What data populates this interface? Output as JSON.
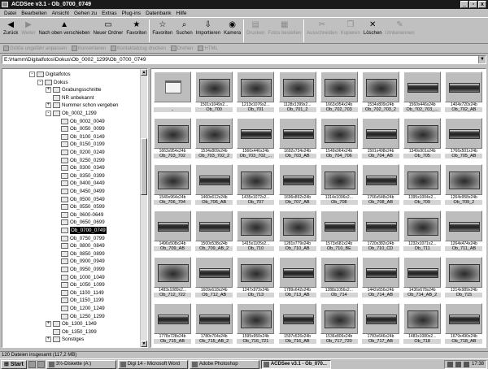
{
  "window": {
    "title": "ACDSee v3.1 - Ob_0700_0749",
    "minimize": "_",
    "restore": "▫",
    "close": "x"
  },
  "menu": [
    "Datei",
    "Bearbeiten",
    "Ansicht",
    "Gehen zu",
    "Extras",
    "Plug-ins",
    "Datenbank",
    "Hilfe"
  ],
  "toolbar": [
    {
      "label": "Zurück",
      "icon": "back-arrow-icon",
      "glyph": "◀",
      "disabled": false
    },
    {
      "label": "Weiter",
      "icon": "forward-arrow-icon",
      "glyph": "▶",
      "disabled": true
    },
    {
      "label": "Nach oben verschieben",
      "icon": "up-folder-icon",
      "glyph": "▲",
      "disabled": false
    },
    {
      "label": "Neuer Ordner",
      "icon": "new-folder-icon",
      "glyph": "▭",
      "disabled": false
    },
    {
      "label": "Favoriten",
      "icon": "favorites-icon",
      "glyph": "★",
      "disabled": false
    },
    {
      "label": "Favoriten",
      "icon": "favorites-menu-icon",
      "glyph": "☆",
      "disabled": false
    },
    {
      "label": "Suchen",
      "icon": "binoculars-icon",
      "glyph": "⌕",
      "disabled": false
    },
    {
      "label": "Importieren",
      "icon": "import-icon",
      "glyph": "⇩",
      "disabled": false
    },
    {
      "label": "Kamera",
      "icon": "camera-icon",
      "glyph": "◉",
      "disabled": false
    },
    {
      "label": "Drucken",
      "icon": "printer-icon",
      "glyph": "▤",
      "disabled": true
    },
    {
      "label": "Fotos bestellen",
      "icon": "order-photos-icon",
      "glyph": "▦",
      "disabled": true
    },
    {
      "label": "Ausschneiden",
      "icon": "scissors-icon",
      "glyph": "✂",
      "disabled": true
    },
    {
      "label": "Kopieren",
      "icon": "copy-icon",
      "glyph": "❐",
      "disabled": true
    },
    {
      "label": "Löschen",
      "icon": "delete-icon",
      "glyph": "✕",
      "disabled": false
    },
    {
      "label": "Umbenennen",
      "icon": "rename-icon",
      "glyph": "✎",
      "disabled": true
    }
  ],
  "toolbar2": [
    "Größe ungefähr anpassen",
    "Konvertieren",
    "Kontaktabzug drucken",
    "Drehen",
    "HTML"
  ],
  "path": "E:\\Hamm\\Digitalfotos\\Dokus\\Ob_0002_1299\\Ob_0700_0749",
  "tree": [
    {
      "label": "Digitalfotos",
      "level": 0,
      "exp": "-",
      "sel": false
    },
    {
      "label": "Dokus",
      "level": 1,
      "exp": "-",
      "sel": false
    },
    {
      "label": "Grabungsschnitte",
      "level": 2,
      "exp": "+",
      "sel": false
    },
    {
      "label": "NR unbekannt",
      "level": 2,
      "exp": "",
      "sel": false
    },
    {
      "label": "Nummer schon vergeben",
      "level": 2,
      "exp": "+",
      "sel": false
    },
    {
      "label": "Ob_0002_1299",
      "level": 2,
      "exp": "-",
      "sel": false
    },
    {
      "label": "Ob_0002_0049",
      "level": 3,
      "exp": "",
      "sel": false
    },
    {
      "label": "Ob_0050_0099",
      "level": 3,
      "exp": "",
      "sel": false
    },
    {
      "label": "Ob_0100_0149",
      "level": 3,
      "exp": "",
      "sel": false
    },
    {
      "label": "Ob_0150_0199",
      "level": 3,
      "exp": "",
      "sel": false
    },
    {
      "label": "Ob_0200_0249",
      "level": 3,
      "exp": "",
      "sel": false
    },
    {
      "label": "Ob_0250_0299",
      "level": 3,
      "exp": "",
      "sel": false
    },
    {
      "label": "Ob_0300_0349",
      "level": 3,
      "exp": "",
      "sel": false
    },
    {
      "label": "Ob_0350_0399",
      "level": 3,
      "exp": "",
      "sel": false
    },
    {
      "label": "Ob_0400_0449",
      "level": 3,
      "exp": "",
      "sel": false
    },
    {
      "label": "Ob_0450_0499",
      "level": 3,
      "exp": "",
      "sel": false
    },
    {
      "label": "Ob_0500_0549",
      "level": 3,
      "exp": "",
      "sel": false
    },
    {
      "label": "Ob_0550_0599",
      "level": 3,
      "exp": "",
      "sel": false
    },
    {
      "label": "Ob_0600-0649",
      "level": 3,
      "exp": "",
      "sel": false
    },
    {
      "label": "Ob_0650_0699",
      "level": 3,
      "exp": "",
      "sel": false
    },
    {
      "label": "Ob_0700_0749",
      "level": 3,
      "exp": "",
      "sel": true
    },
    {
      "label": "Ob_0750_0799",
      "level": 3,
      "exp": "",
      "sel": false
    },
    {
      "label": "Ob_0800_0849",
      "level": 3,
      "exp": "",
      "sel": false
    },
    {
      "label": "Ob_0850_0899",
      "level": 3,
      "exp": "",
      "sel": false
    },
    {
      "label": "Ob_0900_0949",
      "level": 3,
      "exp": "",
      "sel": false
    },
    {
      "label": "Ob_0950_0999",
      "level": 3,
      "exp": "",
      "sel": false
    },
    {
      "label": "Ob_1000_1049",
      "level": 3,
      "exp": "",
      "sel": false
    },
    {
      "label": "Ob_1050_1099",
      "level": 3,
      "exp": "",
      "sel": false
    },
    {
      "label": "Ob_1100_1149",
      "level": 3,
      "exp": "",
      "sel": false
    },
    {
      "label": "Ob_1150_1199",
      "level": 3,
      "exp": "",
      "sel": false
    },
    {
      "label": "Ob_1200_1249",
      "level": 3,
      "exp": "",
      "sel": false
    },
    {
      "label": "Ob_1250_1299",
      "level": 3,
      "exp": "",
      "sel": false
    },
    {
      "label": "Ob_1300_1349",
      "level": 2,
      "exp": "+",
      "sel": false
    },
    {
      "label": "Ob_1350_1399",
      "level": 2,
      "exp": "",
      "sel": false
    },
    {
      "label": "Sonstiges",
      "level": 2,
      "exp": "+",
      "sel": false
    }
  ],
  "thumbnails": [
    {
      "name": "..",
      "size": "",
      "kind": "folder"
    },
    {
      "name": "Ob_700",
      "size": "1501x1049x2...",
      "kind": "photo"
    },
    {
      "name": "Ob_701",
      "size": "1213x1076x2...",
      "kind": "photo"
    },
    {
      "name": "Ob_701_2",
      "size": "1128x1399x2...",
      "kind": "photo"
    },
    {
      "name": "Ob_702_703",
      "size": "1663x954x24b",
      "kind": "photo"
    },
    {
      "name": "Ob_702_703_2",
      "size": "1534x809x24b",
      "kind": "photo"
    },
    {
      "name": "Ob_702_703_...",
      "size": "1560x446x24b",
      "kind": "strip"
    },
    {
      "name": "Ob_702_AB",
      "size": "1404x720x24b",
      "kind": "strip"
    },
    {
      "name": "Ob_703_702",
      "size": "1663x954x24b",
      "kind": "photo"
    },
    {
      "name": "Ob_703_702_2",
      "size": "1534x809x24b",
      "kind": "photo"
    },
    {
      "name": "Ob_703_702_...",
      "size": "1560x446x24b",
      "kind": "strip"
    },
    {
      "name": "Ob_703_AB",
      "size": "1692x734x24b",
      "kind": "strip"
    },
    {
      "name": "Ob_704_706",
      "size": "1549x964x24b",
      "kind": "photo"
    },
    {
      "name": "Ob_704_AB",
      "size": "1501x498x24b",
      "kind": "strip"
    },
    {
      "name": "Ob_705",
      "size": "1349x901x24b",
      "kind": "photo"
    },
    {
      "name": "Ob_705_AB",
      "size": "1766x501x24b",
      "kind": "strip"
    },
    {
      "name": "Ob_706_704",
      "size": "1549x964x24b",
      "kind": "photo"
    },
    {
      "name": "Ob_706_AB",
      "size": "1460x612x24b",
      "kind": "strip"
    },
    {
      "name": "Ob_707",
      "size": "1435x1072x2...",
      "kind": "photo"
    },
    {
      "name": "Ob_707_AB",
      "size": "1696x892x24b",
      "kind": "strip"
    },
    {
      "name": "Ob_708",
      "size": "1314x1096x2...",
      "kind": "photo"
    },
    {
      "name": "Ob_708_AB",
      "size": "1766x548x24b",
      "kind": "strip"
    },
    {
      "name": "Ob_709",
      "size": "1395x1004x2...",
      "kind": "photo"
    },
    {
      "name": "Ob_709_2",
      "size": "1264x958x24b",
      "kind": "photo"
    },
    {
      "name": "Ob_709_AB",
      "size": "1496x508x24b",
      "kind": "strip"
    },
    {
      "name": "Ob_709_AB_2",
      "size": "1500x538x24b",
      "kind": "strip"
    },
    {
      "name": "Ob_710",
      "size": "1415x1105x2...",
      "kind": "photo"
    },
    {
      "name": "Ob_710_AB",
      "size": "1281x779x24b",
      "kind": "photo"
    },
    {
      "name": "Ob_710_BE",
      "size": "1573x681x24b",
      "kind": "strip"
    },
    {
      "name": "Ob_710_CD",
      "size": "1720x382x24b",
      "kind": "strip"
    },
    {
      "name": "Ob_711",
      "size": "1232x1071x2...",
      "kind": "photo"
    },
    {
      "name": "Ob_711_AB",
      "size": "1264x474x24b",
      "kind": "strip"
    },
    {
      "name": "Ob_712_722",
      "size": "1483x1089x2...",
      "kind": "photo"
    },
    {
      "name": "Ob_712_AB",
      "size": "1609x618x24b",
      "kind": "strip"
    },
    {
      "name": "Ob_713",
      "size": "1247x973x24b",
      "kind": "photo"
    },
    {
      "name": "Ob_713_AB",
      "size": "1789x642x24b",
      "kind": "strip"
    },
    {
      "name": "Ob_714",
      "size": "1288x1056x2...",
      "kind": "photo"
    },
    {
      "name": "Ob_714_AB",
      "size": "1442x656x24b",
      "kind": "strip"
    },
    {
      "name": "Ob_714_AB_2",
      "size": "1436x678x24b",
      "kind": "strip"
    },
    {
      "name": "Ob_715",
      "size": "1214x989x24b",
      "kind": "photo"
    },
    {
      "name": "Ob_715_AB",
      "size": "1778x728x24b",
      "kind": "strip"
    },
    {
      "name": "Ob_715_AB_2",
      "size": "1780x704x24b",
      "kind": "strip"
    },
    {
      "name": "Ob_716_721",
      "size": "1595x950x24b",
      "kind": "photo"
    },
    {
      "name": "Ob_716_AB",
      "size": "1597x526x24b",
      "kind": "strip"
    },
    {
      "name": "Ob_717_720",
      "size": "1536x806x24b",
      "kind": "photo"
    },
    {
      "name": "Ob_717_AB",
      "size": "1783x646x24b",
      "kind": "strip"
    },
    {
      "name": "Ob_718",
      "size": "1483x1080x2...",
      "kind": "photo"
    },
    {
      "name": "Ob_718_AB",
      "size": "1679x490x24b",
      "kind": "strip"
    }
  ],
  "status": "120 Dateien insgesamt (117,2 MB)",
  "taskbar": {
    "start": "Start",
    "tasks": [
      {
        "label": "3½-Diskette (A:)",
        "active": false
      },
      {
        "label": "Digi 14 - Microsoft Word",
        "active": false
      },
      {
        "label": "Adobe Photoshop",
        "active": false
      },
      {
        "label": "ACDSee v3.1 - Ob_070...",
        "active": true
      }
    ],
    "clock": "17:38"
  }
}
